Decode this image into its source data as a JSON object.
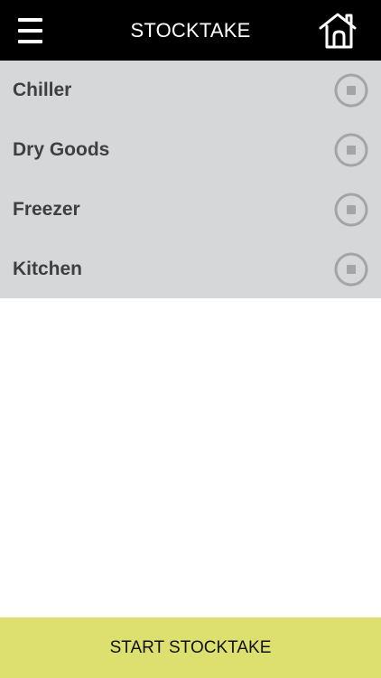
{
  "header": {
    "title": "STOCKTAKE",
    "menu_icon": "hamburger-menu-icon",
    "home_icon": "home-icon"
  },
  "locations": [
    {
      "label": "Chiller",
      "state": "stopped"
    },
    {
      "label": "Dry Goods",
      "state": "stopped"
    },
    {
      "label": "Freezer",
      "state": "stopped"
    },
    {
      "label": "Kitchen",
      "state": "stopped"
    }
  ],
  "footer": {
    "start_label": "START STOCKTAKE"
  },
  "colors": {
    "header_bg": "#000000",
    "list_bg": "#d6d7d9",
    "toggle_gray": "#a3a4a6",
    "footer_bg": "#dde06e"
  }
}
